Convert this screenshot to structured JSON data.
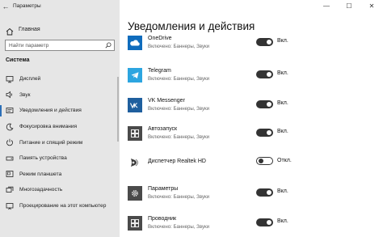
{
  "window": {
    "title": "Параметры",
    "controls": {
      "minimize": "—",
      "maximize": "☐",
      "close": "✕"
    }
  },
  "sidebar": {
    "home_label": "Главная",
    "search_placeholder": "Найти параметр",
    "section_label": "Система",
    "items": [
      {
        "label": "Дисплей",
        "icon": "display-icon",
        "selected": false
      },
      {
        "label": "Звук",
        "icon": "sound-icon",
        "selected": false
      },
      {
        "label": "Уведомления и действия",
        "icon": "notifications-icon",
        "selected": true
      },
      {
        "label": "Фокусировка внимания",
        "icon": "moon-icon",
        "selected": false
      },
      {
        "label": "Питание и спящий режим",
        "icon": "power-icon",
        "selected": false
      },
      {
        "label": "Память устройства",
        "icon": "storage-icon",
        "selected": false
      },
      {
        "label": "Режим планшета",
        "icon": "tablet-icon",
        "selected": false
      },
      {
        "label": "Многозадачность",
        "icon": "multitask-icon",
        "selected": false
      },
      {
        "label": "Проецирование на этот компьютер",
        "icon": "projecting-icon",
        "selected": false
      }
    ]
  },
  "main": {
    "title": "Уведомления и действия",
    "apps": [
      {
        "name": "OneDrive",
        "sub": "Включено: Баннеры, Звуки",
        "state": "Вкл.",
        "on": true,
        "icon": "onedrive-icon",
        "color": "#0f6cbd"
      },
      {
        "name": "Telegram",
        "sub": "Включено: Баннеры, Звуки",
        "state": "Вкл.",
        "on": true,
        "icon": "telegram-icon",
        "color": "#2ca5e0"
      },
      {
        "name": "VK Messenger",
        "sub": "Включено: Баннеры, Звуки",
        "state": "Вкл.",
        "on": true,
        "icon": "vk-icon",
        "color": "#1f5f9e"
      },
      {
        "name": "Автозапуск",
        "sub": "Включено: Баннеры, Звуки",
        "state": "Вкл.",
        "on": true,
        "icon": "autoplay-icon",
        "color": "#4a4a4a"
      },
      {
        "name": "Диспетчер Realtek HD",
        "sub": "",
        "state": "Откл.",
        "on": false,
        "icon": "realtek-icon",
        "color": "#ffffff"
      },
      {
        "name": "Параметры",
        "sub": "Включено: Баннеры, Звуки",
        "state": "Вкл.",
        "on": true,
        "icon": "settings-gear-icon",
        "color": "#4a4a4a"
      },
      {
        "name": "Проводник",
        "sub": "Включено: Баннеры, Звуки",
        "state": "Вкл.",
        "on": true,
        "icon": "explorer-icon",
        "color": "#4a4a4a"
      }
    ]
  }
}
